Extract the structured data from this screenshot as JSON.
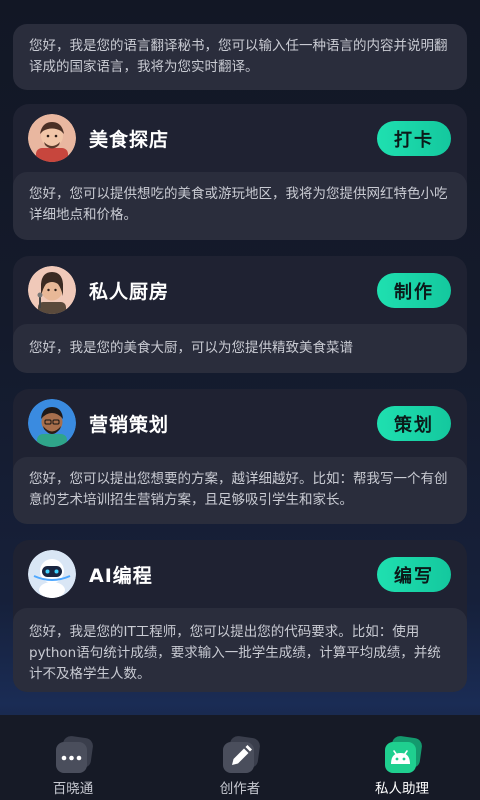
{
  "intro": {
    "text": "您好，我是您的语言翻译秘书，您可以输入任一种语言的内容并说明翻译成的国家语言，我将为您实时翻译。"
  },
  "cards": [
    {
      "title": "美食探店",
      "button": "打卡",
      "avatar_icon": "food-explorer-avatar",
      "desc": "您好，您可以提供想吃的美食或游玩地区，我将为您提供网红特色小吃详细地点和价格。"
    },
    {
      "title": "私人厨房",
      "button": "制作",
      "avatar_icon": "chef-avatar",
      "desc": "您好，我是您的美食大厨，可以为您提供精致美食菜谱"
    },
    {
      "title": "营销策划",
      "button": "策划",
      "avatar_icon": "marketer-avatar",
      "desc": "您好，您可以提出您想要的方案，越详细越好。比如：帮我写一个有创意的艺术培训招生营销方案，且足够吸引学生和家长。"
    },
    {
      "title": "AI编程",
      "button": "编写",
      "avatar_icon": "robot-avatar",
      "desc": "您好，我是您的IT工程师，您可以提出您的代码要求。比如：使用python语句统计成绩，要求输入一批学生成绩，计算平均成绩，并统计不及格学生人数。"
    }
  ],
  "tabbar": {
    "items": [
      {
        "label": "百晓通",
        "icon": "chat-dots-icon",
        "active": false
      },
      {
        "label": "创作者",
        "icon": "pen-icon",
        "active": false
      },
      {
        "label": "私人助理",
        "icon": "android-robot-icon",
        "active": true
      }
    ]
  },
  "colors": {
    "accent": "#1fe0b0",
    "card_bg": "#1f2232",
    "desc_bg": "#2a2d3c",
    "page_bg": "#0d1220"
  }
}
